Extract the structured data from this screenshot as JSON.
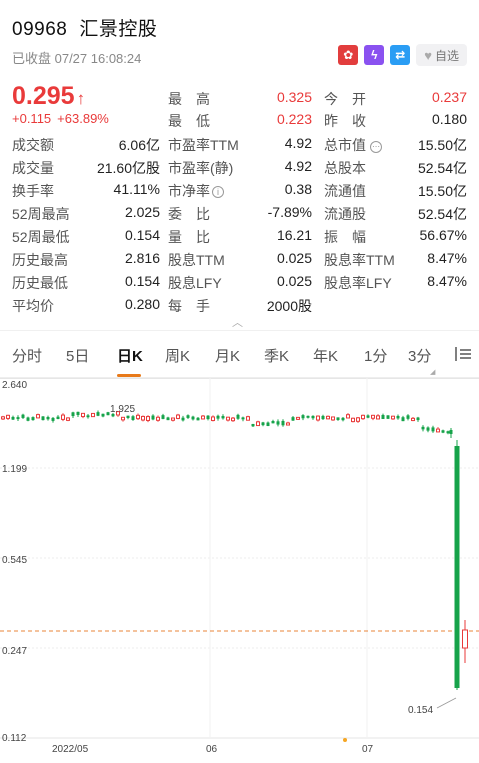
{
  "header": {
    "code": "09968",
    "name": "汇景控股",
    "status": "已收盘 07/27 16:08:24",
    "watch_label": "自选"
  },
  "quote": {
    "price": "0.295",
    "change": "+0.115",
    "change_pct": "+63.89%",
    "grid": [
      {
        "label": "最　高",
        "value": "0.325",
        "color": "red"
      },
      {
        "label": "今　开",
        "value": "0.237",
        "color": "red"
      },
      {
        "label": "最　低",
        "value": "0.223",
        "color": "red"
      },
      {
        "label": "昨　收",
        "value": "0.180",
        "color": "dark"
      },
      {
        "label": "成交额",
        "value": "6.06亿"
      },
      {
        "label": "市盈率TTM",
        "value": "4.92"
      },
      {
        "label": "总市值",
        "value": "15.50亿"
      },
      {
        "label": "成交量",
        "value": "21.60亿股"
      },
      {
        "label": "市盈率(静)",
        "value": "4.92"
      },
      {
        "label": "总股本",
        "value": "52.54亿"
      },
      {
        "label": "换手率",
        "value": "41.11%"
      },
      {
        "label": "市净率",
        "value": "0.38"
      },
      {
        "label": "流通值",
        "value": "15.50亿"
      },
      {
        "label": "52周最高",
        "value": "2.025"
      },
      {
        "label": "委　比",
        "value": "-7.89%"
      },
      {
        "label": "流通股",
        "value": "52.54亿"
      },
      {
        "label": "52周最低",
        "value": "0.154"
      },
      {
        "label": "量　比",
        "value": "16.21"
      },
      {
        "label": "振　幅",
        "value": "56.67%"
      },
      {
        "label": "历史最高",
        "value": "2.816"
      },
      {
        "label": "股息TTM",
        "value": "0.025"
      },
      {
        "label": "股息率TTM",
        "value": "8.47%"
      },
      {
        "label": "历史最低",
        "value": "0.154"
      },
      {
        "label": "股息LFY",
        "value": "0.025"
      },
      {
        "label": "股息率LFY",
        "value": "8.47%"
      },
      {
        "label": "平均价",
        "value": "0.280"
      },
      {
        "label": "每　手",
        "value": "2000股"
      }
    ]
  },
  "tabs": [
    "分时",
    "5日",
    "日K",
    "周K",
    "月K",
    "季K",
    "年K",
    "1分",
    "3分"
  ],
  "active_tab": "日K",
  "chart_data": {
    "type": "candlestick",
    "y_ticks": [
      "2.640",
      "1.199",
      "0.545",
      "0.247",
      "0.112"
    ],
    "x_ticks": [
      "2022/05",
      "06",
      "07"
    ],
    "annotations": {
      "high_label": "1.925",
      "low_label": "0.154"
    },
    "last_close": 0.295,
    "colors": {
      "up": "#e93a3a",
      "down": "#16a34a",
      "ref_line": "#e8843a"
    }
  },
  "colors": {
    "up": "#e93a3a",
    "down": "#16a34a",
    "accent": "#e87a1a"
  }
}
